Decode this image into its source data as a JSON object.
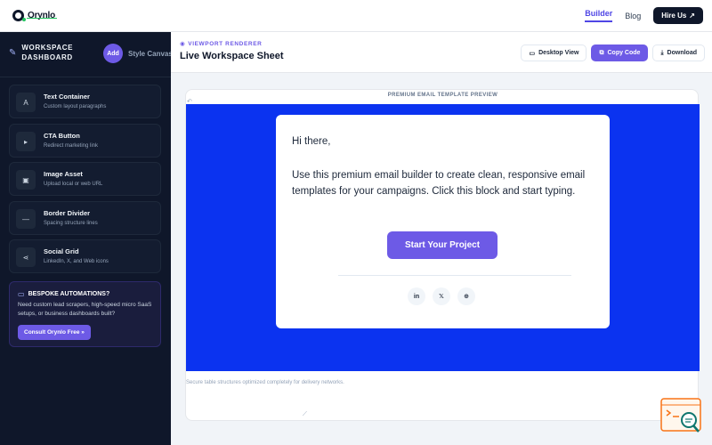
{
  "header": {
    "logo_text": "Orynlo",
    "nav": [
      {
        "label": "Builder",
        "active": true
      },
      {
        "label": "Blog",
        "active": false
      }
    ],
    "hire_label": "Hire Us",
    "hire_icon": "↗"
  },
  "sidebar": {
    "title": "WORKSPACE DASHBOARD",
    "tab_add": "Add",
    "tab_style": "Style Canvas",
    "blocks": [
      {
        "title": "Text Container",
        "subtitle": "Custom layout paragraphs",
        "icon": "A",
        "icon_name": "text-icon"
      },
      {
        "title": "CTA Button",
        "subtitle": "Redirect marketing link",
        "icon": "▸",
        "icon_name": "cursor-icon"
      },
      {
        "title": "Image Asset",
        "subtitle": "Upload local or web URL",
        "icon": "▣",
        "icon_name": "image-icon"
      },
      {
        "title": "Border Divider",
        "subtitle": "Spacing structure lines",
        "icon": "—",
        "icon_name": "divider-icon"
      },
      {
        "title": "Social Grid",
        "subtitle": "LinkedIn, X, and Web icons",
        "icon": "⋖",
        "icon_name": "share-icon"
      }
    ],
    "promo": {
      "title": "BESPOKE AUTOMATIONS?",
      "text": "Need custom lead scrapers, high-speed micro SaaS setups, or business dashboards built?",
      "button": "Consult Orynlo Free »"
    }
  },
  "main": {
    "renderer_label": "VIEWPORT RENDERER",
    "title": "Live Workspace Sheet",
    "actions": {
      "desktop": "Desktop View",
      "copy": "Copy Code",
      "download": "Download"
    },
    "canvas_label": "PREMIUM EMAIL TEMPLATE PREVIEW",
    "email": {
      "greeting": "Hi there,",
      "body": "Use this premium email builder to create clean, responsive email templates for your campaigns. Click this block and start typing.",
      "cta": "Start Your Project",
      "socials": [
        "in",
        "𝕏",
        "⊕"
      ]
    },
    "footer_note": "Secure table structures optimized completely for delivery networks."
  },
  "colors": {
    "accent": "#6d5ae6",
    "canvas_bg": "#0b33f0",
    "sidebar_bg": "#0f172a"
  }
}
